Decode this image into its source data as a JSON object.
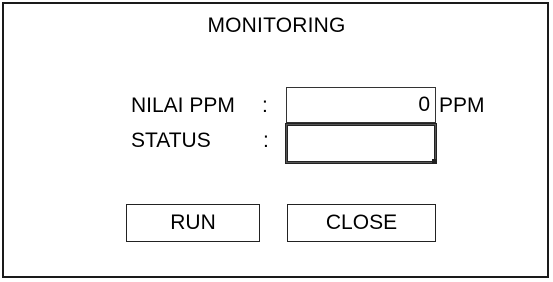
{
  "title": "MONITORING",
  "fields": {
    "ppm": {
      "label": "NILAI PPM",
      "colon": ":",
      "value": "0",
      "unit": "PPM"
    },
    "status": {
      "label": "STATUS",
      "colon": ":",
      "value": ""
    }
  },
  "buttons": {
    "run_label": "RUN",
    "close_label": "CLOSE"
  }
}
